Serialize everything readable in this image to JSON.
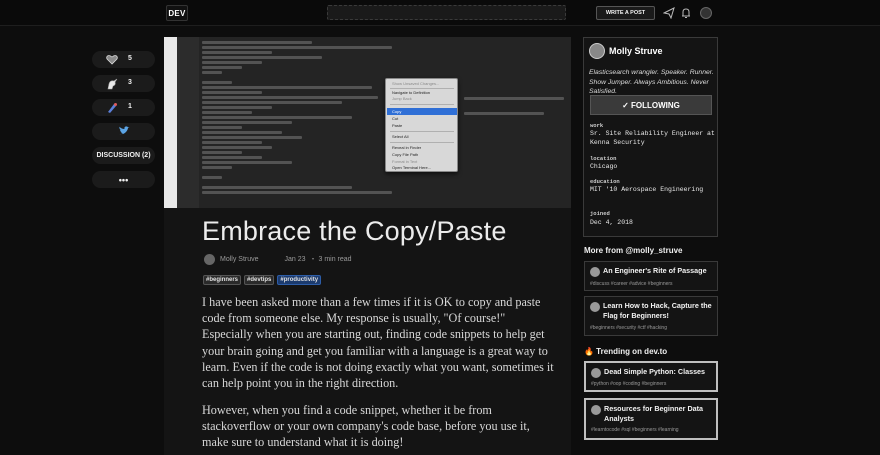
{
  "header": {
    "logo_text": "DEV",
    "write_post_label": "WRITE A POST",
    "icons": [
      "paper-plane-icon",
      "bell-icon",
      "user-avatar"
    ]
  },
  "reactions": {
    "hearts": "5",
    "unicorns": "3",
    "bookmarks": "1",
    "discussion_label": "DISCUSSION (2)",
    "more_label": "•••"
  },
  "cover_menu": {
    "items": [
      "Show Unsaved Changes...",
      "Navigate to Definition",
      "Jump Back",
      "Copy",
      "Cut",
      "Paste",
      "Select All",
      "Reveal in Finder",
      "Copy File Path",
      "Format in Text",
      "Open Terminal Here..."
    ]
  },
  "article": {
    "title": "Embrace the Copy/Paste",
    "author": "Molly Struve",
    "date": "Jan 23",
    "read_time": "・ 3 min read",
    "tags": [
      "#beginners",
      "#devtips",
      "#productivity"
    ],
    "paragraphs": [
      "I have been asked more than a few times if it is OK to copy and paste code from someone else. My response is usually, \"Of course!\" Especially when you are starting out, finding code snippets to help get your brain going and get you familiar with a language is a great way to learn. Even if the code is not doing exactly what you want, sometimes it can help point you in the right direction.",
      "However, when you find a code snippet, whether it be from stackoverflow or your own company's code base, before you use it, make sure to understand what it is doing!"
    ]
  },
  "profile": {
    "name": "Molly Struve",
    "bio": "Elasticsearch wrangler. Speaker. Runner. Show Jumper. Always Ambitious. Never Satisfied.",
    "follow_label": "✓ FOLLOWING",
    "work_label": "work",
    "work_value": "Sr. Site Reliability Engineer at Kenna Security",
    "location_label": "location",
    "location_value": "Chicago",
    "education_label": "education",
    "education_value": "MIT '10 Aerospace Engineering",
    "joined_label": "joined",
    "joined_value": "Dec 4, 2018"
  },
  "more_from": {
    "heading": "More from @molly_struve",
    "items": [
      {
        "title": "An Engineer's Rite of Passage",
        "tags": "#discuss #career #advice #beginners"
      },
      {
        "title": "Learn How to Hack, Capture the Flag for Beginners!",
        "tags": "#beginners #security #ctf #hacking"
      }
    ]
  },
  "trending": {
    "heading": "🔥 Trending on dev.to",
    "items": [
      {
        "title": "Dead Simple Python: Classes",
        "tags": "#python #oop #coding #beginners"
      },
      {
        "title": "Resources for Beginner Data Analysts",
        "tags": "#learntocode #sql #beginners #learning"
      }
    ]
  }
}
